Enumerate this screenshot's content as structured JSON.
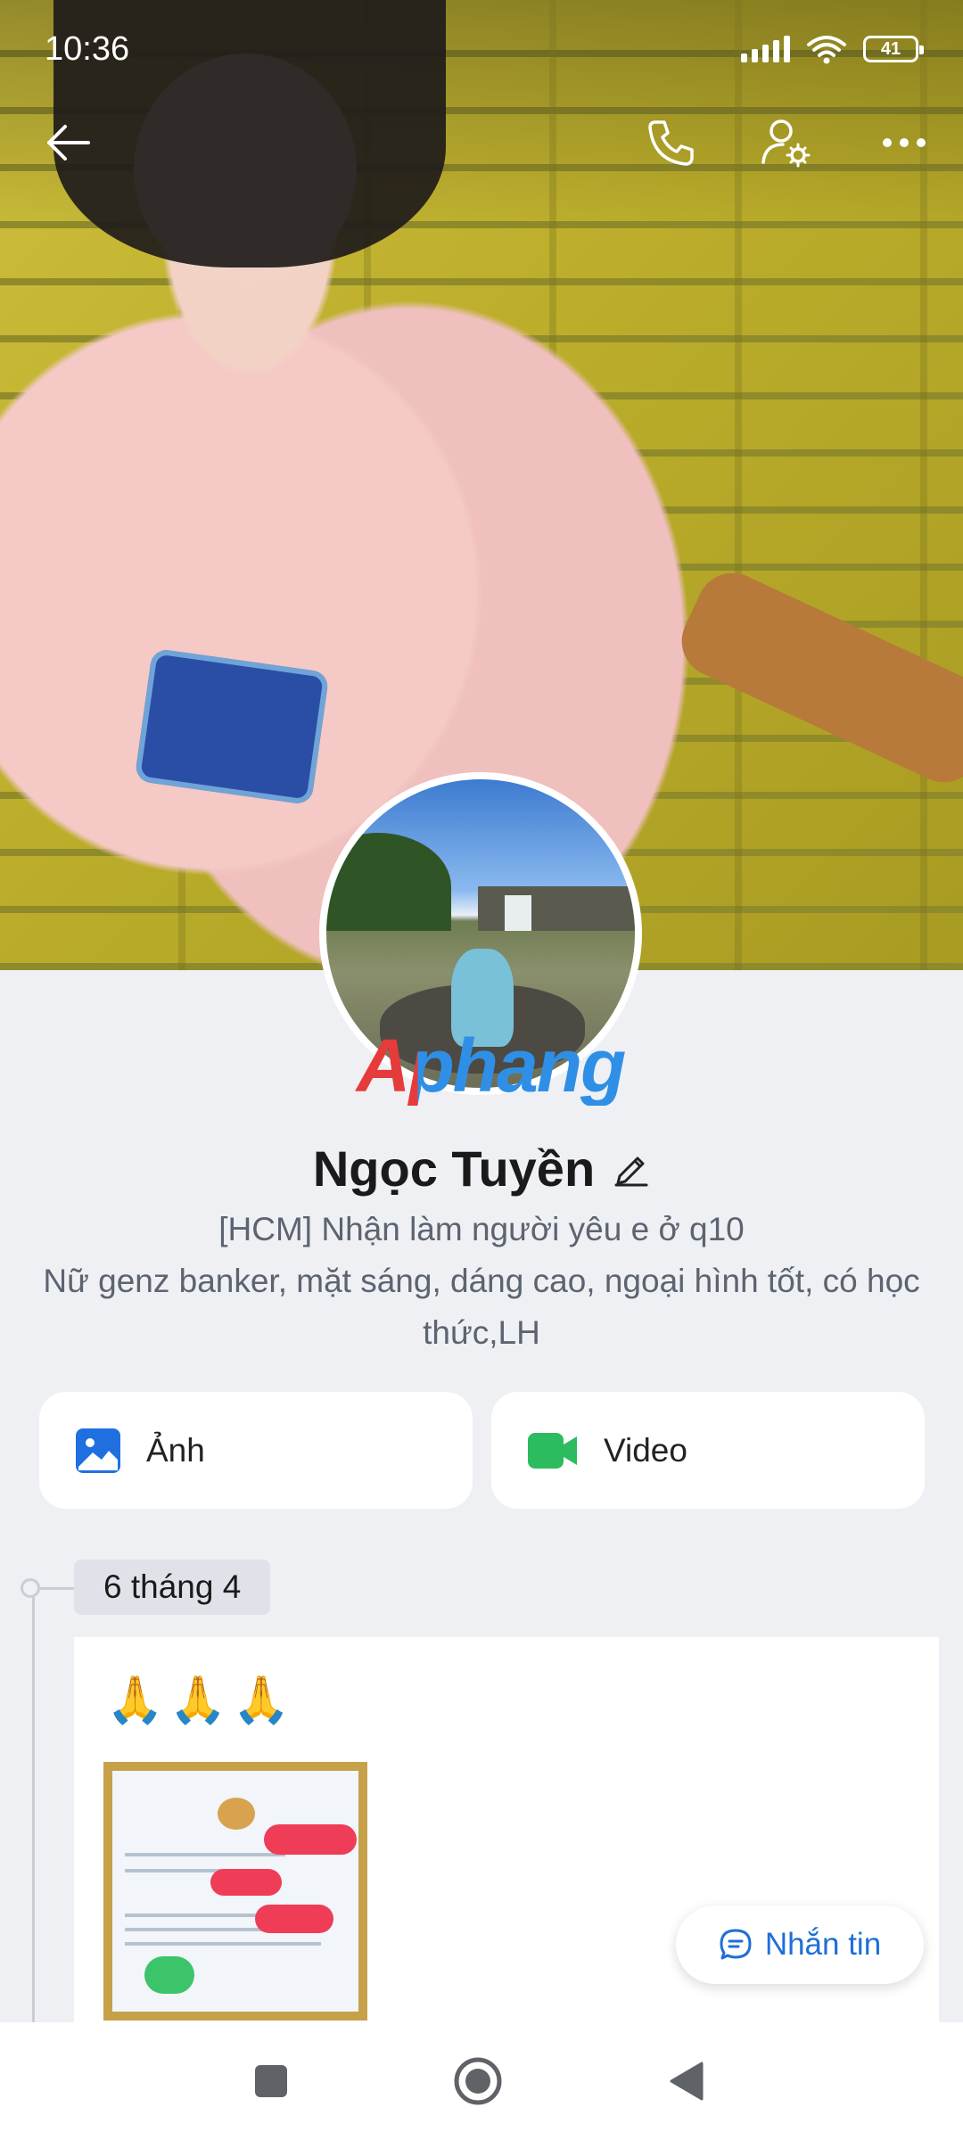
{
  "status_bar": {
    "time": "10:36",
    "battery": "41",
    "icons": [
      "signal-icon",
      "wifi-icon",
      "battery-icon"
    ]
  },
  "top_nav": {
    "icons": [
      "back-arrow-icon",
      "phone-icon",
      "user-settings-icon",
      "more-icon"
    ]
  },
  "profile": {
    "name": "Ngọc Tuyền",
    "bio_line_1": "[HCM] Nhận làm người yêu e ở q10",
    "bio_line_2": "Nữ genz banker, mặt sáng, dáng cao, ngoại hình tốt, có học thức,LH",
    "watermark": "Aphang"
  },
  "media": {
    "photo_label": "Ảnh",
    "video_label": "Video"
  },
  "timeline": {
    "date": "6 tháng 4",
    "post_text": "🙏🙏🙏"
  },
  "actions": {
    "message_label": "Nhắn tin"
  },
  "colors": {
    "accent": "#1e6fd9",
    "photo_icon": "#1f6fe0",
    "video_icon": "#2dbb5f",
    "background": "#eef0f4"
  }
}
